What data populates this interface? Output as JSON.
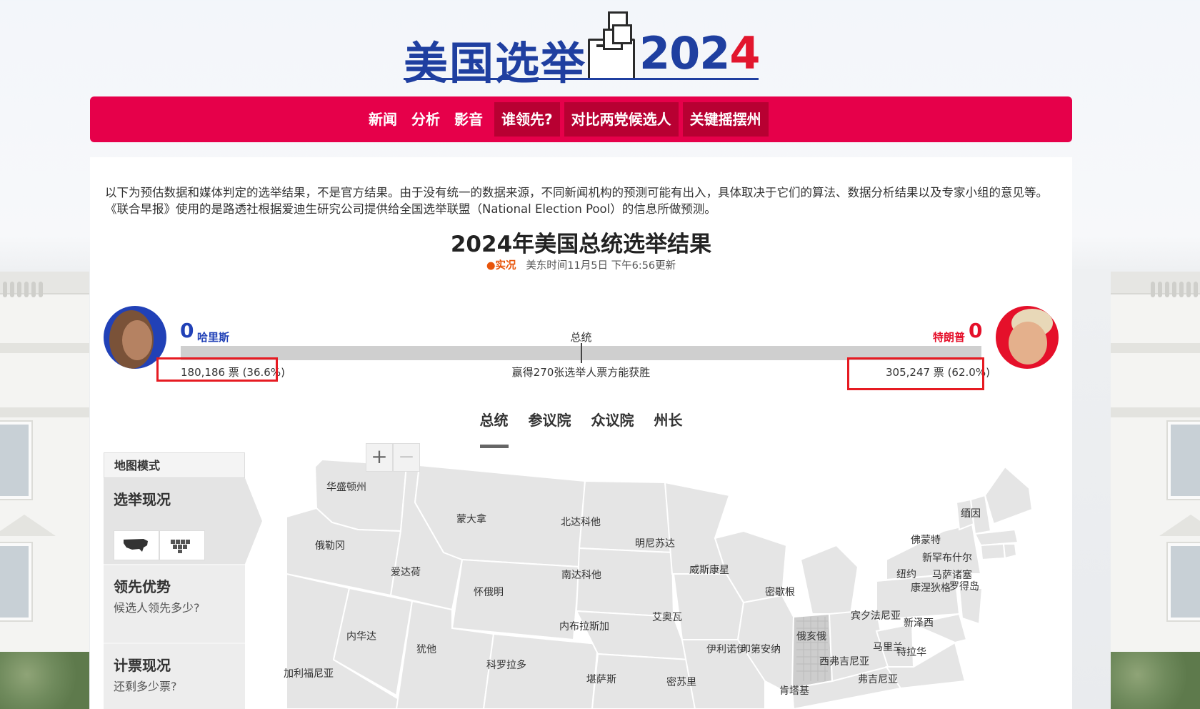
{
  "logo": {
    "title_cn": "美国选举",
    "year_a": "202",
    "year_b": "4"
  },
  "nav": {
    "items": [
      "新闻",
      "分析",
      "影音",
      "谁领先?",
      "对比两党候选人",
      "关键摇摆州"
    ]
  },
  "disclaimer": "以下为预估数据和媒体判定的选举结果，不是官方结果。由于没有统一的数据来源，不同新闻机构的预测可能有出入，具体取决于它们的算法、数据分析结果以及专家小组的意见等。《联合早报》使用的是路透社根据爱迪生研究公司提供给全国选举联盟（National Election Pool）的信息所做预测。",
  "results": {
    "title": "2024年美国总统选举结果",
    "live_label": "实况",
    "updated": "美东时间11月5日 下午6:56更新",
    "race_label": "总统",
    "win_note": "赢得270张选举人票方能获胜",
    "dem": {
      "name": "哈里斯",
      "electoral": "0",
      "votes": "180,186 票 (36.6%)",
      "color": "#2141b7"
    },
    "rep": {
      "name": "特朗普",
      "electoral": "0",
      "votes": "305,247 票 (62.0%)",
      "color": "#e5102a"
    }
  },
  "tabs": [
    "总统",
    "参议院",
    "众议院",
    "州长"
  ],
  "sidebar": {
    "header": "地图模式",
    "sections": [
      {
        "title": "选举现况",
        "subtitle": ""
      },
      {
        "title": "领先优势",
        "subtitle": "候选人领先多少?"
      },
      {
        "title": "计票现况",
        "subtitle": "还剩多少票?"
      }
    ]
  },
  "map": {
    "zoom_in": "+",
    "zoom_out": "−",
    "states": [
      "华盛顿州",
      "俄勒冈",
      "加利福尼亚",
      "爱达荷",
      "内华达",
      "蒙大拿",
      "怀俄明",
      "犹他",
      "科罗拉多",
      "北达科他",
      "南达科他",
      "内布拉斯加",
      "堪萨斯",
      "明尼苏达",
      "艾奥瓦",
      "密苏里",
      "威斯康星",
      "伊利诺伊",
      "印第安纳",
      "密歇根",
      "俄亥俄",
      "肯塔基",
      "宾夕法尼亚",
      "西弗吉尼亚",
      "弗吉尼亚",
      "纽约",
      "佛蒙特",
      "新罕布什尔",
      "缅因",
      "马萨诸塞",
      "罗得岛",
      "康涅狄格",
      "新泽西",
      "马里兰",
      "特拉华"
    ]
  }
}
